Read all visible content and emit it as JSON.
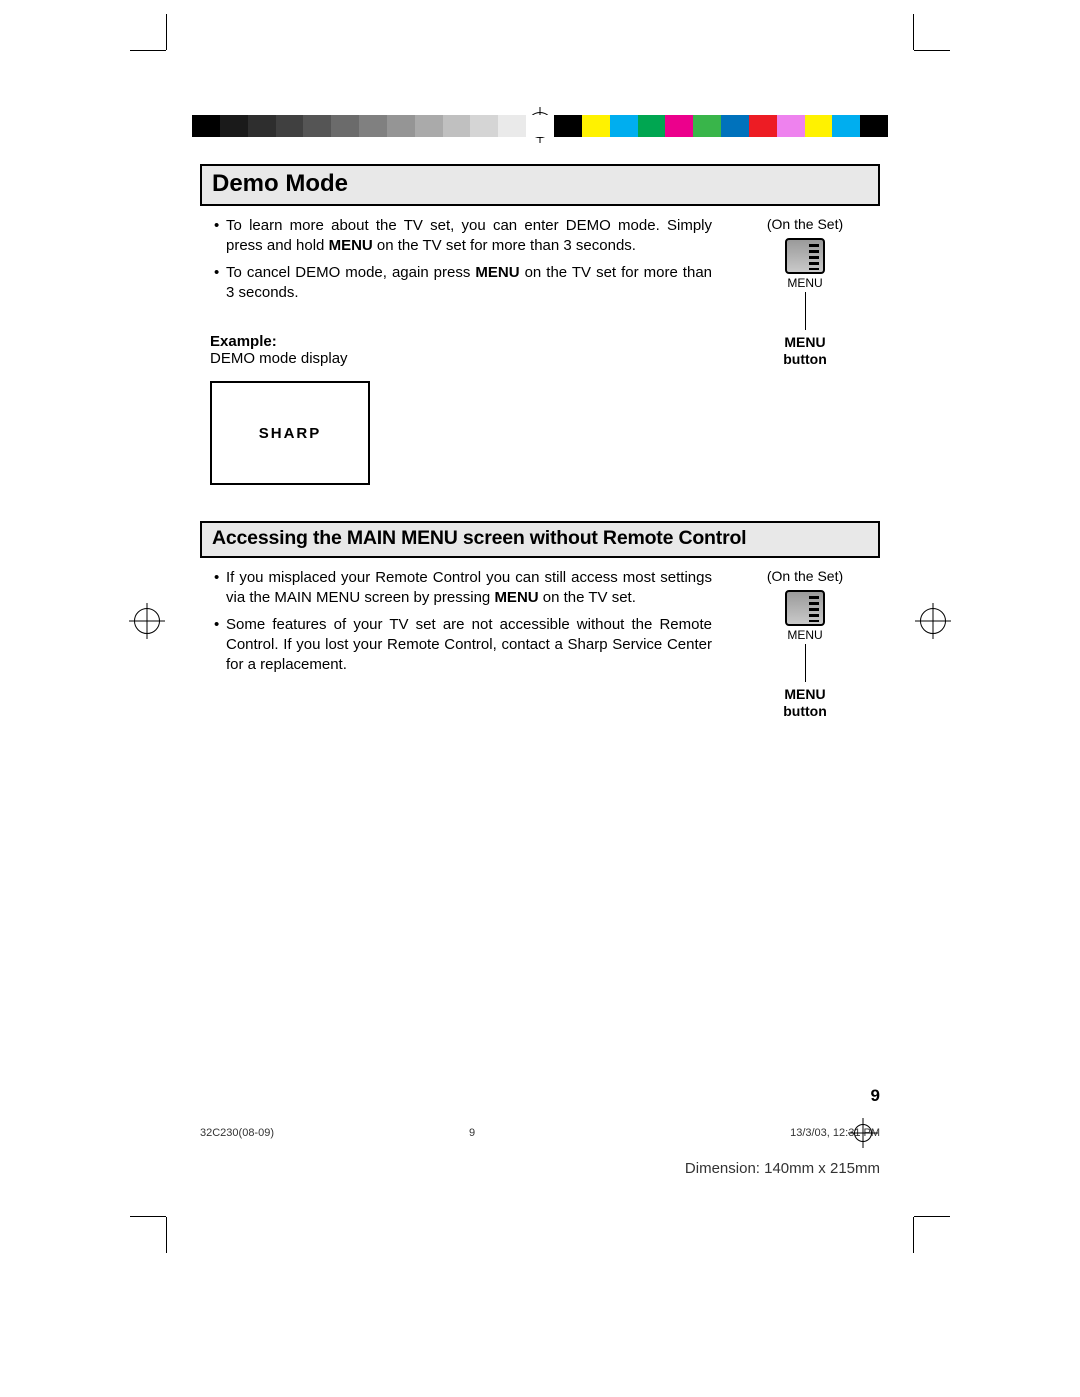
{
  "colorbar": [
    "#000000",
    "#1a1a1a",
    "#2e2e2e",
    "#404040",
    "#555555",
    "#6b6b6b",
    "#808080",
    "#959595",
    "#aaaaaa",
    "#c0c0c0",
    "#d5d5d5",
    "#eaeaea",
    "#ffffff",
    "#000000",
    "#fff200",
    "#00aeef",
    "#00a651",
    "#ec008c",
    "#39b54a",
    "#0072bc",
    "#ed1c24",
    "#ee82ee",
    "#fff200",
    "#00aeef",
    "#000000"
  ],
  "section1": {
    "title": "Demo Mode",
    "bullets": [
      {
        "pre": "To learn more about the TV set, you can enter DEMO mode. Simply press and hold ",
        "bold": "MENU",
        "post": " on the TV set for more than 3 seconds."
      },
      {
        "pre": "To cancel DEMO mode, again press ",
        "bold": "MENU",
        "post": " on the TV set for more than 3 seconds."
      }
    ],
    "example_label": "Example:",
    "example_sub": "DEMO mode display",
    "demo_brand": "SHARP",
    "on_set": "(On  the  Set)",
    "menu_small": "MENU",
    "menu_bold_1": "MENU",
    "menu_bold_2": "button"
  },
  "section2": {
    "title": "Accessing the MAIN MENU screen without Remote Control",
    "bullets": [
      {
        "pre": "If you misplaced your Remote Control you can still access most settings via the MAIN MENU screen by pressing ",
        "bold": "MENU",
        "post": " on the TV set."
      },
      {
        "pre": "Some features of your TV set are not accessible without the Remote Control. If you lost your Remote Control, contact a Sharp Service Center for a replacement.",
        "bold": "",
        "post": ""
      }
    ],
    "on_set": "(On  the  Set)",
    "menu_small": "MENU",
    "menu_bold_1": "MENU",
    "menu_bold_2": "button"
  },
  "page_number": "9",
  "footer": {
    "left": "32C230(08-09)",
    "mid": "9",
    "right": "13/3/03, 12:31 PM"
  },
  "dimension": "Dimension: 140mm x 215mm"
}
